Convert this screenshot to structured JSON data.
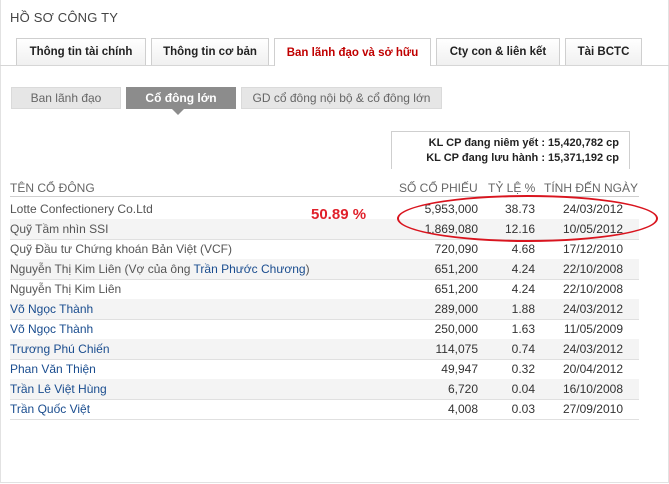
{
  "page_title": "HỒ SƠ CÔNG TY",
  "tabs": [
    {
      "label": "Thông tin tài chính"
    },
    {
      "label": "Thông tin cơ bản"
    },
    {
      "label": "Ban lãnh đạo và sở hữu"
    },
    {
      "label": "Cty con & liên kết"
    },
    {
      "label": "Tài BCTC"
    }
  ],
  "subtabs": [
    {
      "label": "Ban lãnh đạo"
    },
    {
      "label": "Cổ đông lớn"
    },
    {
      "label": "GD cổ đông nội bộ & cổ đông lớn"
    }
  ],
  "kl": {
    "listed": "KL CP đang niêm yết : 15,420,782 cp",
    "outstanding": "KL CP đang lưu hành : 15,371,192 cp"
  },
  "table": {
    "headers": [
      "TÊN CỔ ĐÔNG",
      "SỐ CỔ PHIẾU",
      "TỶ LỆ %",
      "TÍNH ĐẾN NGÀY"
    ],
    "rows": [
      {
        "name": "Lotte Confectionery Co.Ltd",
        "shares": "5,953,000",
        "pct": "38.73",
        "date": "24/03/2012"
      },
      {
        "name": "Quỹ Tầm nhìn SSI",
        "shares": "1,869,080",
        "pct": "12.16",
        "date": "10/05/2012"
      },
      {
        "name": "Quỹ Đầu tư Chứng khoán Bản Việt (VCF)",
        "shares": "720,090",
        "pct": "4.68",
        "date": "17/12/2010"
      },
      {
        "name_prefix": "Nguyễn Thị Kim Liên (Vợ của ông ",
        "name_link": "Trần Phước Chương",
        "name_suffix": ")",
        "shares": "651,200",
        "pct": "4.24",
        "date": "22/10/2008"
      },
      {
        "name": "Nguyễn Thị Kim Liên",
        "shares": "651,200",
        "pct": "4.24",
        "date": "22/10/2008"
      },
      {
        "name": "Võ Ngọc Thành",
        "shares": "289,000",
        "pct": "1.88",
        "date": "24/03/2012"
      },
      {
        "name": "Võ Ngọc Thành",
        "shares": "250,000",
        "pct": "1.63",
        "date": "11/05/2009"
      },
      {
        "name": "Trương Phú Chiến",
        "shares": "114,075",
        "pct": "0.74",
        "date": "24/03/2012"
      },
      {
        "name": "Phan Văn Thiện",
        "shares": "49,947",
        "pct": "0.32",
        "date": "20/04/2012"
      },
      {
        "name": "Trần Lê Việt Hùng",
        "shares": "6,720",
        "pct": "0.04",
        "date": "16/10/2008"
      },
      {
        "name": "Trần Quốc Việt",
        "shares": "4,008",
        "pct": "0.03",
        "date": "27/09/2010"
      }
    ]
  },
  "annotation": "50.89 %",
  "colors": {
    "active_tab": "#c00000",
    "annotation": "#e0202a",
    "link": "#1a4d8f"
  }
}
